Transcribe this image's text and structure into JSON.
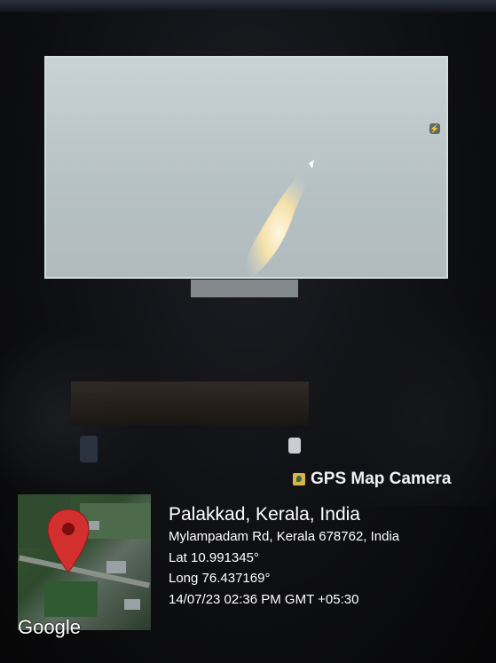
{
  "overlay": {
    "brand": "GPS Map Camera",
    "map_logo": "Google",
    "location": {
      "city_line": "Palakkad, Kerala, India",
      "address": "Mylampadam Rd, Kerala 678762, India",
      "lat": "Lat 10.991345°",
      "long": "Long 76.437169°",
      "timestamp": "14/07/23 02:36 PM GMT +05:30"
    }
  },
  "icons": {
    "map_pin": "map-pin-icon",
    "gps_camera": "gps-camera-icon",
    "screen_badge": "badge-icon"
  },
  "colors": {
    "pin": "#d32f2f",
    "text": "#ffffff",
    "screen": "#c0c9cb"
  }
}
